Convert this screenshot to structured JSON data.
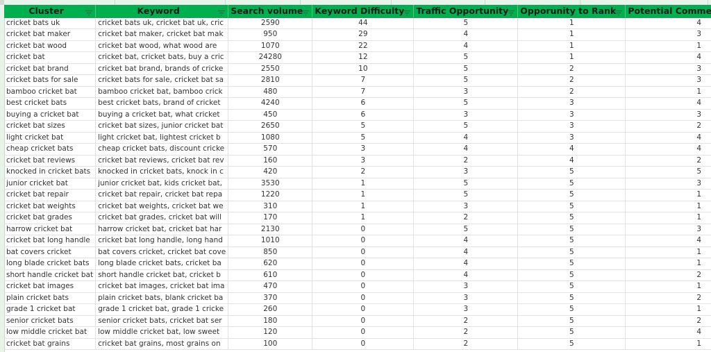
{
  "sheet": {
    "header_color": "#00b04f",
    "columns": [
      {
        "key": "cluster",
        "label": "Cluster",
        "icon": "filter-icon"
      },
      {
        "key": "keyword",
        "label": "Keyword",
        "icon": "filter-icon"
      },
      {
        "key": "search_volume",
        "label": "Search volume",
        "icon": "filter-icon"
      },
      {
        "key": "keyword_difficulty",
        "label": "Keyword Difficulty",
        "icon": "filter-icon"
      },
      {
        "key": "traffic_opportunity",
        "label": "Traffic Opportunity",
        "icon": "filter-icon"
      },
      {
        "key": "opportunity_to_rank",
        "label": "Opporunity to Rank",
        "icon": "filter-icon"
      },
      {
        "key": "potential_commercial_value",
        "label": "Potential Commercial Value",
        "icon": "filter-icon"
      }
    ],
    "rows": [
      {
        "cluster": "cricket bats uk",
        "keyword": "cricket bats uk, cricket bat uk, cric",
        "search_volume": "2590",
        "keyword_difficulty": "44",
        "traffic_opportunity": "5",
        "opportunity_to_rank": "1",
        "potential_commercial_value": "4"
      },
      {
        "cluster": "cricket bat maker",
        "keyword": "cricket bat maker, cricket bat mak",
        "search_volume": "950",
        "keyword_difficulty": "29",
        "traffic_opportunity": "4",
        "opportunity_to_rank": "1",
        "potential_commercial_value": "3"
      },
      {
        "cluster": "cricket bat wood",
        "keyword": "cricket bat wood, what wood are",
        "search_volume": "1070",
        "keyword_difficulty": "22",
        "traffic_opportunity": "4",
        "opportunity_to_rank": "1",
        "potential_commercial_value": "1"
      },
      {
        "cluster": "cricket bat",
        "keyword": "cricket bat, cricket bats, buy a cric",
        "search_volume": "24280",
        "keyword_difficulty": "12",
        "traffic_opportunity": "5",
        "opportunity_to_rank": "1",
        "potential_commercial_value": "4"
      },
      {
        "cluster": "cricket bat brand",
        "keyword": "cricket bat brand, brands of cricke",
        "search_volume": "2550",
        "keyword_difficulty": "10",
        "traffic_opportunity": "5",
        "opportunity_to_rank": "2",
        "potential_commercial_value": "3"
      },
      {
        "cluster": "cricket bats for sale",
        "keyword": "cricket bats for sale, cricket bat sa",
        "search_volume": "2810",
        "keyword_difficulty": "7",
        "traffic_opportunity": "5",
        "opportunity_to_rank": "2",
        "potential_commercial_value": "3"
      },
      {
        "cluster": "bamboo cricket bat",
        "keyword": "bamboo cricket bat, bamboo crick",
        "search_volume": "480",
        "keyword_difficulty": "7",
        "traffic_opportunity": "3",
        "opportunity_to_rank": "2",
        "potential_commercial_value": "1"
      },
      {
        "cluster": "best cricket bats",
        "keyword": "best cricket bats, brand of cricket",
        "search_volume": "4240",
        "keyword_difficulty": "6",
        "traffic_opportunity": "5",
        "opportunity_to_rank": "3",
        "potential_commercial_value": "4"
      },
      {
        "cluster": "buying a cricket bat",
        "keyword": "buying a cricket bat, what cricket",
        "search_volume": "450",
        "keyword_difficulty": "6",
        "traffic_opportunity": "3",
        "opportunity_to_rank": "3",
        "potential_commercial_value": "3"
      },
      {
        "cluster": "cricket bat sizes",
        "keyword": "cricket bat sizes, junior cricket bat",
        "search_volume": "2650",
        "keyword_difficulty": "5",
        "traffic_opportunity": "5",
        "opportunity_to_rank": "3",
        "potential_commercial_value": "2"
      },
      {
        "cluster": "light cricket bat",
        "keyword": "light cricket bat, lightest cricket b",
        "search_volume": "1080",
        "keyword_difficulty": "5",
        "traffic_opportunity": "4",
        "opportunity_to_rank": "3",
        "potential_commercial_value": "4"
      },
      {
        "cluster": "cheap cricket bats",
        "keyword": "cheap cricket bats, discount cricke",
        "search_volume": "570",
        "keyword_difficulty": "3",
        "traffic_opportunity": "4",
        "opportunity_to_rank": "4",
        "potential_commercial_value": "4"
      },
      {
        "cluster": "cricket bat reviews",
        "keyword": "cricket bat reviews, cricket bat rev",
        "search_volume": "160",
        "keyword_difficulty": "3",
        "traffic_opportunity": "2",
        "opportunity_to_rank": "4",
        "potential_commercial_value": "2"
      },
      {
        "cluster": "knocked in cricket bats",
        "keyword": "knocked in cricket bats, knock in c",
        "search_volume": "420",
        "keyword_difficulty": "2",
        "traffic_opportunity": "3",
        "opportunity_to_rank": "5",
        "potential_commercial_value": "5"
      },
      {
        "cluster": "junior cricket bat",
        "keyword": "junior cricket bat, kids cricket bat,",
        "search_volume": "3530",
        "keyword_difficulty": "1",
        "traffic_opportunity": "5",
        "opportunity_to_rank": "5",
        "potential_commercial_value": "3"
      },
      {
        "cluster": "cricket bat repair",
        "keyword": "cricket bat repair, cricket bat repa",
        "search_volume": "1220",
        "keyword_difficulty": "1",
        "traffic_opportunity": "5",
        "opportunity_to_rank": "5",
        "potential_commercial_value": "1"
      },
      {
        "cluster": "cricket bat weights",
        "keyword": "cricket bat weights, cricket bat we",
        "search_volume": "310",
        "keyword_difficulty": "1",
        "traffic_opportunity": "3",
        "opportunity_to_rank": "5",
        "potential_commercial_value": "1"
      },
      {
        "cluster": "cricket bat grades",
        "keyword": "cricket bat grades, cricket bat will",
        "search_volume": "170",
        "keyword_difficulty": "1",
        "traffic_opportunity": "2",
        "opportunity_to_rank": "5",
        "potential_commercial_value": "1"
      },
      {
        "cluster": "harrow cricket bat",
        "keyword": "harrow cricket bat, cricket bat har",
        "search_volume": "2130",
        "keyword_difficulty": "0",
        "traffic_opportunity": "5",
        "opportunity_to_rank": "5",
        "potential_commercial_value": "3"
      },
      {
        "cluster": "cricket bat long handle",
        "keyword": "cricket bat long handle, long hand",
        "search_volume": "1010",
        "keyword_difficulty": "0",
        "traffic_opportunity": "4",
        "opportunity_to_rank": "5",
        "potential_commercial_value": "4"
      },
      {
        "cluster": "bat covers cricket",
        "keyword": "bat covers cricket, cricket bat cove",
        "search_volume": "850",
        "keyword_difficulty": "0",
        "traffic_opportunity": "4",
        "opportunity_to_rank": "5",
        "potential_commercial_value": "1"
      },
      {
        "cluster": "long blade cricket bats",
        "keyword": "long blade cricket bats, cricket ba",
        "search_volume": "620",
        "keyword_difficulty": "0",
        "traffic_opportunity": "4",
        "opportunity_to_rank": "5",
        "potential_commercial_value": "1"
      },
      {
        "cluster": "short handle cricket bat",
        "keyword": "short handle cricket bat, cricket b",
        "search_volume": "610",
        "keyword_difficulty": "0",
        "traffic_opportunity": "4",
        "opportunity_to_rank": "5",
        "potential_commercial_value": "2"
      },
      {
        "cluster": "cricket bat images",
        "keyword": "cricket bat images, cricket bat ima",
        "search_volume": "470",
        "keyword_difficulty": "0",
        "traffic_opportunity": "3",
        "opportunity_to_rank": "5",
        "potential_commercial_value": "1"
      },
      {
        "cluster": "plain cricket bats",
        "keyword": "plain cricket bats, blank cricket ba",
        "search_volume": "370",
        "keyword_difficulty": "0",
        "traffic_opportunity": "3",
        "opportunity_to_rank": "5",
        "potential_commercial_value": "2"
      },
      {
        "cluster": "grade 1 cricket bat",
        "keyword": "grade 1 cricket bat, grade 1 cricke",
        "search_volume": "260",
        "keyword_difficulty": "0",
        "traffic_opportunity": "3",
        "opportunity_to_rank": "5",
        "potential_commercial_value": "1"
      },
      {
        "cluster": "senior cricket bats",
        "keyword": "senior cricket bats, cricket bat ser",
        "search_volume": "180",
        "keyword_difficulty": "0",
        "traffic_opportunity": "2",
        "opportunity_to_rank": "5",
        "potential_commercial_value": "2"
      },
      {
        "cluster": "low middle cricket bat",
        "keyword": "low middle cricket bat, low sweet",
        "search_volume": "120",
        "keyword_difficulty": "0",
        "traffic_opportunity": "2",
        "opportunity_to_rank": "5",
        "potential_commercial_value": "4"
      },
      {
        "cluster": "cricket bat grains",
        "keyword": "cricket bat grains, most grains on",
        "search_volume": "100",
        "keyword_difficulty": "0",
        "traffic_opportunity": "2",
        "opportunity_to_rank": "5",
        "potential_commercial_value": "1"
      }
    ]
  }
}
